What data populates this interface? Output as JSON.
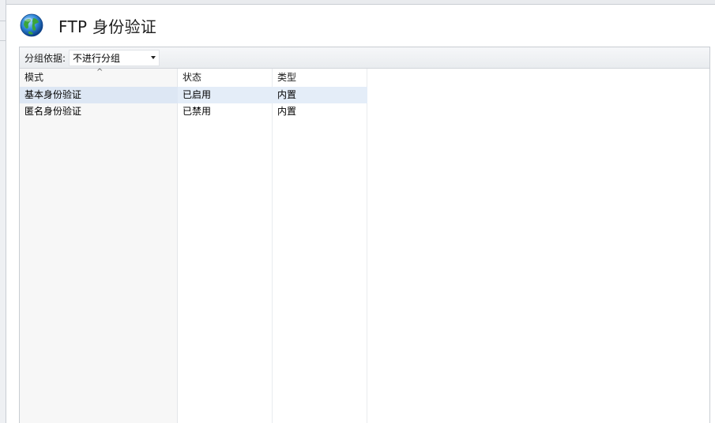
{
  "header": {
    "title": "FTP 身份验证",
    "icon": "globe-icon"
  },
  "toolbar": {
    "group_label": "分组依据:",
    "group_value": "不进行分组"
  },
  "table": {
    "columns": [
      "模式",
      "状态",
      "类型"
    ],
    "rows": [
      {
        "mode": "基本身份验证",
        "status": "已启用",
        "type": "内置",
        "selected": true
      },
      {
        "mode": "匿名身份验证",
        "status": "已禁用",
        "type": "内置",
        "selected": false
      }
    ]
  },
  "colors": {
    "selected_row": "#e4edf8",
    "toolbar_bg": "#eceef1",
    "mode_column_bg": "#f7f7f7"
  }
}
